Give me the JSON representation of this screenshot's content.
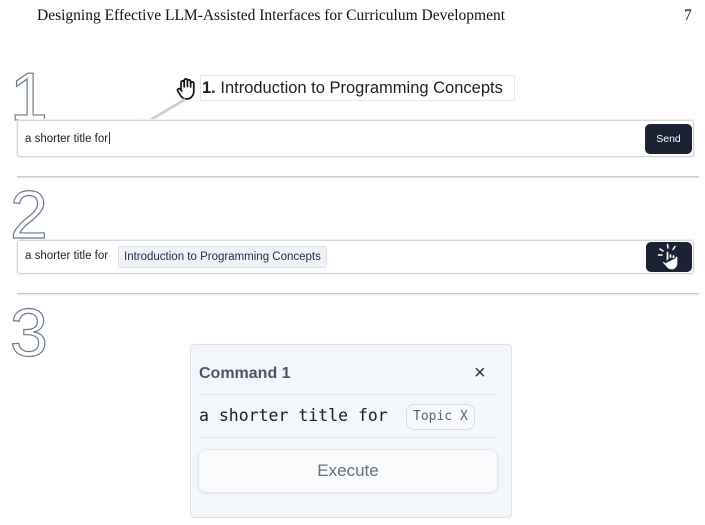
{
  "running_head": {
    "title": "Designing Effective LLM-Assisted Interfaces for Curriculum Development",
    "page_number": "7"
  },
  "steps": [
    {
      "number": "1",
      "dragged_label": {
        "index": "1.",
        "text": "Introduction to Programming Concepts"
      },
      "input_value": "a shorter title for",
      "send_label": "Send"
    },
    {
      "number": "2",
      "input_prefix": "a shorter title for",
      "chip_text": "Introduction to Programming Concepts"
    },
    {
      "number": "3",
      "panel": {
        "title": "Command 1",
        "close_glyph": "×",
        "command_text": "a shorter title for",
        "placeholder_chip": "Topic X",
        "execute_label": "Execute"
      }
    }
  ],
  "colors": {
    "send_button_bg": "#1b2233",
    "chip_bg": "#eff3f8",
    "panel_bg": "#f3f6fa",
    "arrow": "#cfcfcf"
  }
}
